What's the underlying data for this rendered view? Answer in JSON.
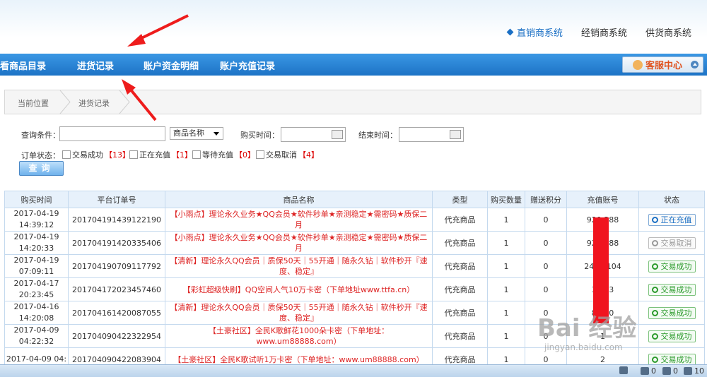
{
  "systems": [
    {
      "label": "直销商系统",
      "active": true
    },
    {
      "label": "经销商系统",
      "active": false
    },
    {
      "label": "供货商系统",
      "active": false
    }
  ],
  "nav": {
    "items": [
      "看商品目录",
      "进货记录",
      "账户资金明细",
      "账户充值记录"
    ],
    "customer_service": "客服中心"
  },
  "breadcrumb": {
    "current_position": "当前位置",
    "page": "进货记录"
  },
  "search": {
    "query_label": "查询条件：",
    "field_select": "商品名称",
    "buy_time_label": "购买时间：",
    "end_time_label": "结束时间：",
    "order_status_label": "订单状态：",
    "statuses": [
      {
        "label": "交易成功",
        "count": "【13】"
      },
      {
        "label": "正在充值",
        "count": "【1】"
      },
      {
        "label": "等待充值",
        "count": "【0】"
      },
      {
        "label": "交易取消",
        "count": "【4】"
      }
    ],
    "query_button": "查询"
  },
  "table": {
    "headers": [
      "购买时间",
      "平台订单号",
      "商品名称",
      "类型",
      "购买数量",
      "赠送积分",
      "充值账号",
      "状态"
    ],
    "rows": [
      {
        "time": "2017-04-19 14:39:12",
        "order": "201704191439122190",
        "name": "【小雨点】理论永久业务★QQ会员★软件秒单★亲测稳定★需密码★质保二月",
        "type": "代充商品",
        "qty": "1",
        "points": "0",
        "account": "920 388",
        "status": "正在充值",
        "status_style": "blue"
      },
      {
        "time": "2017-04-19 14:20:33",
        "order": "201704191420335406",
        "name": "【小雨点】理论永久业务★QQ会员★软件秒单★亲测稳定★需密码★质保二月",
        "type": "代充商品",
        "qty": "1",
        "points": "0",
        "account": "920 388",
        "status": "交易取消",
        "status_style": "grey"
      },
      {
        "time": "2017-04-19 07:09:11",
        "order": "201704190709117792",
        "name": "【清新】理论永久QQ会员｜质保50天｜55开通｜随永久钻｜软件秒开『速度、稳定』",
        "type": "代充商品",
        "qty": "1",
        "points": "0",
        "account": "248 5104",
        "status": "交易成功",
        "status_style": "green"
      },
      {
        "time": "2017-04-17 20:23:45",
        "order": "201704172023457460",
        "name": "【彩虹超级快刷】QQ空间人气10万卡密（下单地址www.ttfa.cn）",
        "type": "代充商品",
        "qty": "1",
        "points": "0",
        "account": "32 33",
        "status": "交易成功",
        "status_style": "green"
      },
      {
        "time": "2017-04-16 14:20:08",
        "order": "201704161420087055",
        "name": "【清新】理论永久QQ会员｜质保50天｜55开通｜随永久钻｜软件秒开『速度、稳定』",
        "type": "代充商品",
        "qty": "1",
        "points": "0",
        "account": "89 90",
        "status": "交易成功",
        "status_style": "green"
      },
      {
        "time": "2017-04-09 04:22:32",
        "order": "201704090422322954",
        "name": "【土豪社区】全民K歌鲜花1000朵卡密（下单地址：www.um88888.com）",
        "type": "代充商品",
        "qty": "1",
        "points": "0",
        "account": "1",
        "status": "交易成功",
        "status_style": "green"
      },
      {
        "time": "2017-04-09 04:",
        "order": "201704090422083904",
        "name": "【土豪社区】全民K歌试听1万卡密（下单地址：www.um88888.com）",
        "type": "代充商品",
        "qty": "1",
        "points": "0",
        "account": "2",
        "status": "交易成功",
        "status_style": "green"
      }
    ]
  },
  "watermark": {
    "text": "Bai 经验",
    "sub": "jingyan.baidu.com"
  },
  "statusbar": {
    "items": [
      "0",
      "0",
      "10"
    ]
  },
  "colors": {
    "nav": "#1d73c6",
    "accent": "#1a6fc4",
    "red": "#d22222",
    "success": "#2b9a2b"
  }
}
